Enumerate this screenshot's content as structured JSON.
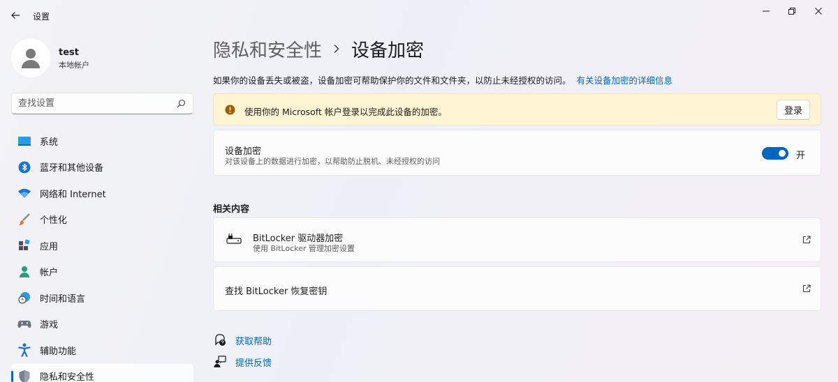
{
  "window": {
    "title": "设置"
  },
  "user": {
    "name": "test",
    "account_type": "本地帐户"
  },
  "search": {
    "placeholder": "查找设置"
  },
  "sidebar": {
    "items": [
      {
        "label": "系统",
        "icon": "system-icon"
      },
      {
        "label": "蓝牙和其他设备",
        "icon": "bluetooth-icon"
      },
      {
        "label": "网络和 Internet",
        "icon": "wifi-icon"
      },
      {
        "label": "个性化",
        "icon": "brush-icon"
      },
      {
        "label": "应用",
        "icon": "apps-icon"
      },
      {
        "label": "帐户",
        "icon": "account-icon"
      },
      {
        "label": "时间和语言",
        "icon": "clock-globe-icon"
      },
      {
        "label": "游戏",
        "icon": "gamepad-icon"
      },
      {
        "label": "辅助功能",
        "icon": "accessibility-icon"
      },
      {
        "label": "隐私和安全性",
        "icon": "shield-icon",
        "active": true
      }
    ]
  },
  "breadcrumb": {
    "parent": "隐私和安全性",
    "current": "设备加密"
  },
  "description": {
    "text": "如果你的设备丢失或被盗，设备加密可帮助保护你的文件和文件夹，以防止未经授权的访问。",
    "link": "有关设备加密的详细信息"
  },
  "warning": {
    "text": "使用你的 Microsoft 帐户登录以完成此设备的加密。",
    "button": "登录"
  },
  "device_encryption": {
    "title": "设备加密",
    "subtitle": "对该设备上的数据进行加密，以帮助防止脱机、未经授权的访问",
    "toggle_state": "开"
  },
  "related": {
    "title": "相关内容",
    "bitlocker": {
      "title": "BitLocker 驱动器加密",
      "subtitle": "使用 BitLocker 管理加密设置"
    },
    "recovery_key": {
      "title": "查找 BitLocker 恢复密钥"
    }
  },
  "help": {
    "get_help": "获取帮助",
    "feedback": "提供反馈"
  },
  "colors": {
    "accent": "#0067c0",
    "warning_bg": "#fcf4d3",
    "warning_icon": "#9d5d00"
  }
}
